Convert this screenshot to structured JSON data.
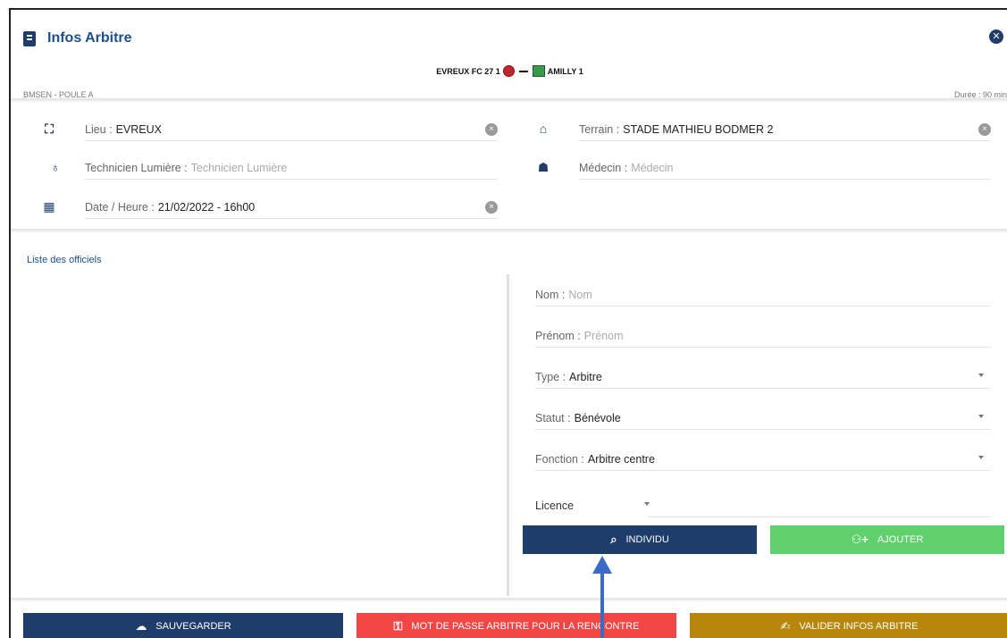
{
  "header": {
    "title": "Infos Arbitre",
    "close_icon": "close-circle-icon"
  },
  "match": {
    "home_team": "EVREUX FC 27 1",
    "away_team": "AMILLY 1",
    "competition": "BMSEN - POULE A",
    "duration": "Durée : 90 min"
  },
  "fields": {
    "lieu": {
      "label": "Lieu :",
      "value": "EVREUX"
    },
    "terrain": {
      "label": "Terrain :",
      "value": "STADE MATHIEU BODMER  2"
    },
    "technicien": {
      "label": "Technicien Lumière :",
      "placeholder": "Technicien Lumière"
    },
    "medecin": {
      "label": "Médecin :",
      "placeholder": "Médecin"
    },
    "date": {
      "label": "Date / Heure :",
      "value": "21/02/2022 - 16h00"
    }
  },
  "officials": {
    "section_title": "Liste des officiels",
    "nom": {
      "label": "Nom :",
      "placeholder": "Nom"
    },
    "prenom": {
      "label": "Prénom :",
      "placeholder": "Prénom"
    },
    "type": {
      "label": "Type :",
      "value": "Arbitre"
    },
    "statut": {
      "label": "Statut :",
      "value": "Bénévole"
    },
    "fonction": {
      "label": "Fonction :",
      "value": "Arbitre centre"
    },
    "licence": {
      "label": "Licence"
    },
    "individu_button": "INDIVIDU",
    "ajouter_button": "AJOUTER"
  },
  "footer": {
    "save_button": "SAUVEGARDER",
    "password_button": "MOT DE PASSE ARBITRE POUR LA RENCONTRE",
    "validate_button": "VALIDER INFOS ARBITRE"
  },
  "colors": {
    "navy": "#1f3d6b",
    "green": "#5fd06b",
    "red": "#f04646",
    "gold": "#b8860b",
    "arrow": "#3a6bc7"
  }
}
